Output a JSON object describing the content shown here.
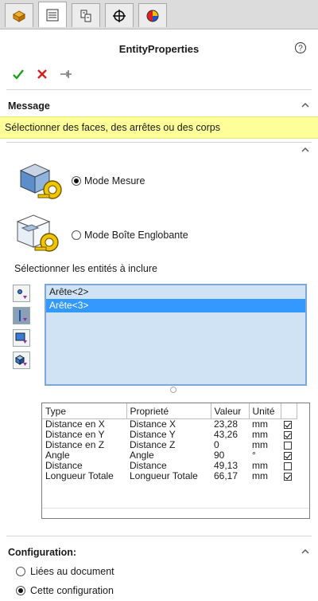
{
  "tabs": [
    {
      "icon": "feature-manager-icon",
      "active": false
    },
    {
      "icon": "property-manager-icon",
      "active": true
    },
    {
      "icon": "configuration-manager-icon",
      "active": false
    },
    {
      "icon": "dimxpert-icon",
      "active": false
    },
    {
      "icon": "appearance-icon",
      "active": false
    }
  ],
  "header": {
    "title": "EntityProperties",
    "help_icon": "help-icon"
  },
  "actions": {
    "ok_icon": "check-icon",
    "cancel_icon": "close-icon",
    "pin_icon": "pushpin-icon"
  },
  "message_section": {
    "label": "Message",
    "text": "Sélectionner des faces, des arrêtes ou des corps"
  },
  "mode_section": {
    "options": [
      {
        "label": "Mode Mesure",
        "checked": true
      },
      {
        "label": "Mode Boîte Englobante",
        "checked": false
      }
    ],
    "select_label": "Sélectionner les entités à inclure",
    "entities": [
      {
        "label": "Arête<2>",
        "selected": false
      },
      {
        "label": "Arête<3>",
        "selected": true
      }
    ]
  },
  "properties_table": {
    "headers": [
      "Type",
      "Proprieté",
      "Valeur",
      "Unité",
      ""
    ],
    "rows": [
      {
        "type": "Distance en X",
        "prop": "Distance X",
        "value": "23,28",
        "unit": "mm",
        "checked": true
      },
      {
        "type": "Distance en Y",
        "prop": "Distance Y",
        "value": "43,26",
        "unit": "mm",
        "checked": true
      },
      {
        "type": "Distance en Z",
        "prop": "Distance Z",
        "value": "0",
        "unit": "mm",
        "checked": false
      },
      {
        "type": "Angle",
        "prop": "Angle",
        "value": "90",
        "unit": "°",
        "checked": true
      },
      {
        "type": "Distance",
        "prop": "Distance",
        "value": "49,13",
        "unit": "mm",
        "checked": false
      },
      {
        "type": "Longueur Totale",
        "prop": "Longueur Totale",
        "value": "66,17",
        "unit": "mm",
        "checked": true
      }
    ]
  },
  "config_section": {
    "label": "Configuration:",
    "options": [
      {
        "label": "Liées au document",
        "checked": false
      },
      {
        "label": "Cette configuration",
        "checked": true
      }
    ]
  },
  "colors": {
    "message_bg": "#ffff99",
    "list_bg": "#cfe3f4",
    "selection": "#3399ff",
    "ok": "#1aa31a",
    "cancel": "#d42020"
  }
}
